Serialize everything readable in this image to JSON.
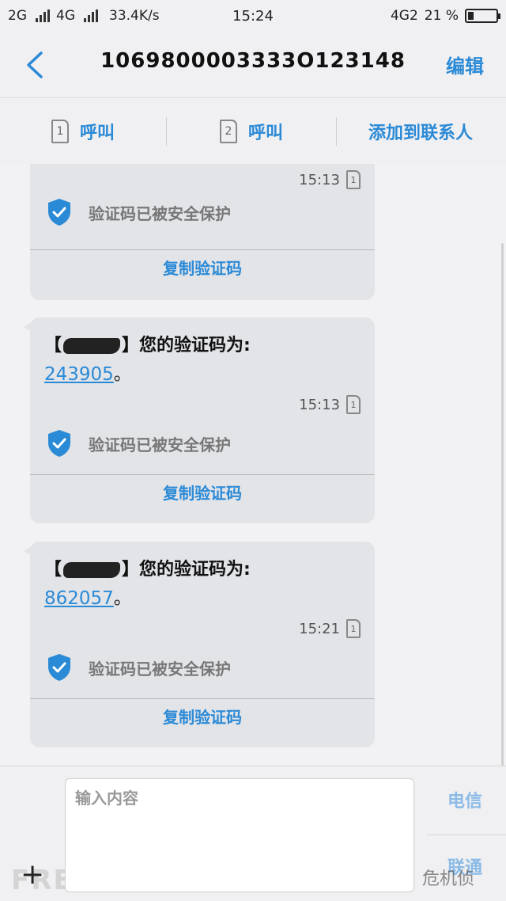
{
  "status_bar": {
    "net1": "2G",
    "net2": "4G",
    "speed": "33.4K/s",
    "time": "15:24",
    "net_right": "4G2",
    "battery_percent": "21 %",
    "battery_level": 0.21
  },
  "header": {
    "title": "1069800003333O123148",
    "edit_label": "编辑"
  },
  "actions": {
    "call_sim1_label": "呼叫",
    "sim1_badge": "1",
    "call_sim2_label": "呼叫",
    "sim2_badge": "2",
    "add_contact_label": "添加到联系人"
  },
  "messages": [
    {
      "time": "15:13",
      "sim": "1",
      "secure_text": "验证码已被安全保护",
      "copy_label": "复制验证码"
    },
    {
      "prefix": "【",
      "suffix": "】您的验证码为:",
      "code": "243905",
      "period": "。",
      "time": "15:13",
      "sim": "1",
      "secure_text": "验证码已被安全保护",
      "copy_label": "复制验证码"
    },
    {
      "prefix": "【",
      "suffix": "】您的验证码为:",
      "code": "862057",
      "period": "。",
      "time": "15:21",
      "sim": "1",
      "secure_text": "验证码已被安全保护",
      "copy_label": "复制验证码"
    }
  ],
  "compose": {
    "placeholder": "输入内容",
    "plus": "+",
    "carrier_label": "电信",
    "carrier2_label": "联通"
  },
  "watermarks": {
    "freebuf": "FREEBUF",
    "right": "危机侦"
  },
  "colors": {
    "accent": "#2b8ad6",
    "shield": "#2b8ad6"
  }
}
